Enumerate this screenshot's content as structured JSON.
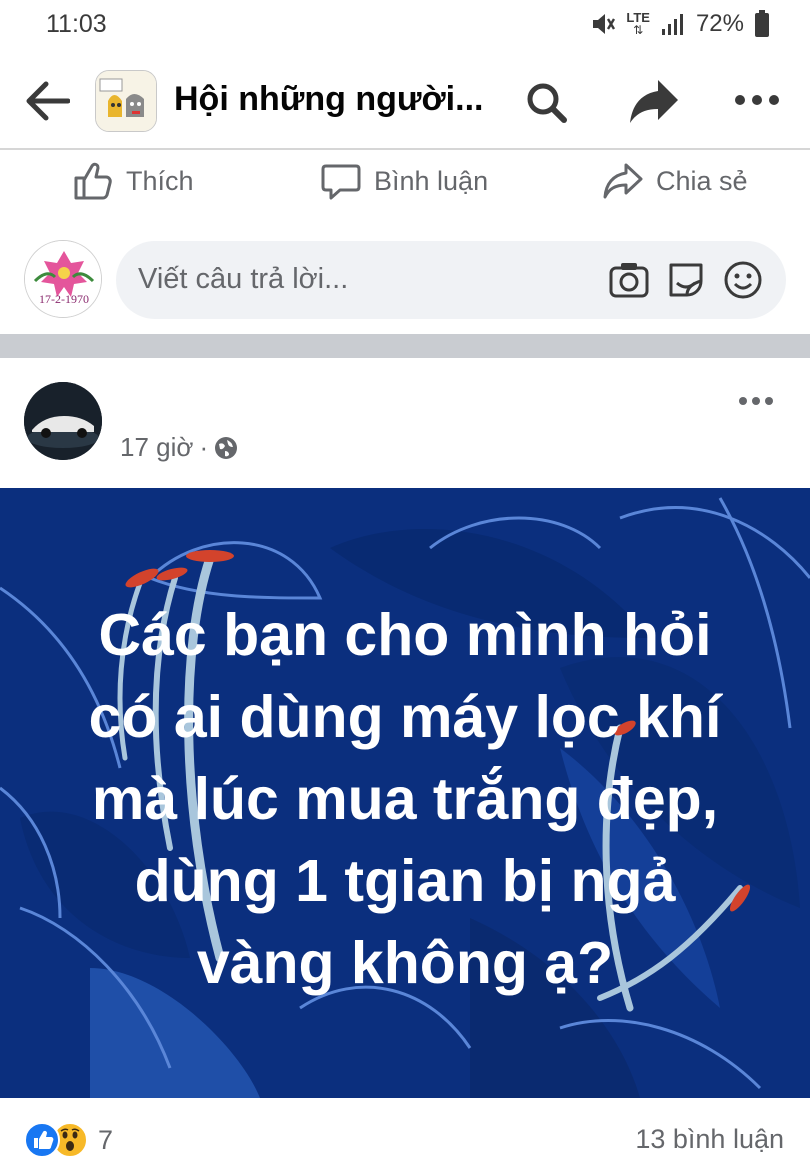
{
  "status_bar": {
    "time": "11:03",
    "network": "LTE",
    "battery": "72%",
    "icons": [
      "mute-icon",
      "lte-icon",
      "signal-icon",
      "battery-icon"
    ]
  },
  "app_bar": {
    "title": "Hội những người...",
    "icons": [
      "back-arrow-icon",
      "group-thumbnail",
      "search-icon",
      "share-icon",
      "more-icon"
    ]
  },
  "actions": {
    "like": "Thích",
    "comment": "Bình luận",
    "share": "Chia sẻ"
  },
  "composer": {
    "placeholder": "Viết câu trả lời...",
    "avatar_caption": "17-2-1970",
    "icons": [
      "camera-icon",
      "sticker-icon",
      "emoji-icon"
    ]
  },
  "post": {
    "author": "",
    "time": "17 giờ",
    "separator": "·",
    "privacy_icon": "globe-icon",
    "text_lines": [
      "Các bạn cho mình hỏi",
      "có ai dùng máy lọc khí",
      "mà lúc mua trắng đẹp,",
      "dùng 1 tgian bị ngả",
      "vàng không ạ?"
    ],
    "background_color": "#0b2f7e",
    "reactions": [
      "like",
      "wow"
    ],
    "reaction_count": "7",
    "comment_count": "13 bình luận"
  },
  "colors": {
    "accent": "#1877f2",
    "secondary_text": "#65676b",
    "divider": "#c9ccd1"
  }
}
